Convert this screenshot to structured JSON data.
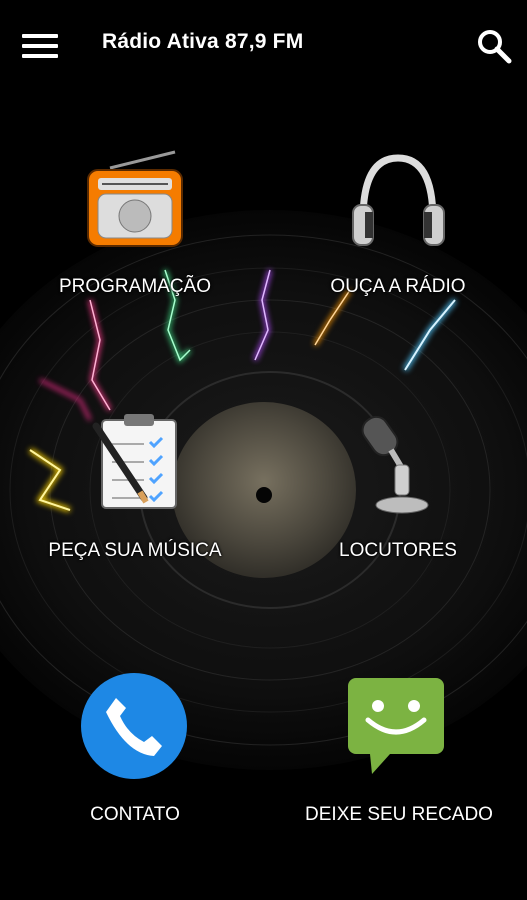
{
  "app": {
    "title": "Rádio Ativa 87,9 FM"
  },
  "toolbar": {
    "menu_icon": "hamburger-menu-icon",
    "search_icon": "search-icon"
  },
  "menu": {
    "programacao": "PROGRAMAÇÃO",
    "ouca": "OUÇA A RÁDIO",
    "peca": "PEÇA SUA MÚSICA",
    "locutores": "LOCUTORES",
    "contato": "CONTATO",
    "recado": "DEIXE SEU RECADO"
  },
  "colors": {
    "phone_blue": "#1e88e5",
    "message_green": "#7cb342",
    "radio_orange": "#f57c00"
  }
}
